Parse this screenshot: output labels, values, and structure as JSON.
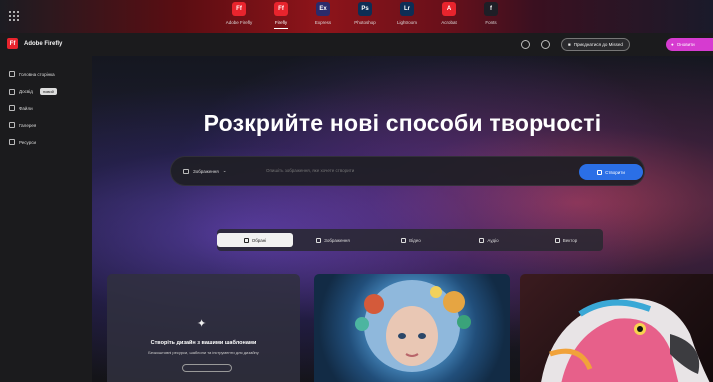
{
  "appbar": {
    "apps": [
      {
        "label": "Adobe Firefly",
        "short": "Ff",
        "color": "#e8242d",
        "active": false
      },
      {
        "label": "Firefly",
        "short": "Ff",
        "color": "#e8242d",
        "active": true
      },
      {
        "label": "Express",
        "short": "Ex",
        "color": "#2b2b6b",
        "active": false
      },
      {
        "label": "Photoshop",
        "short": "Ps",
        "color": "#0d2e55",
        "active": false
      },
      {
        "label": "Lightroom",
        "short": "Lr",
        "color": "#0d2e55",
        "active": false
      },
      {
        "label": "Acrobat",
        "short": "A",
        "color": "#e8242d",
        "active": false
      },
      {
        "label": "Fonts",
        "short": "f",
        "color": "#1e1e26",
        "active": false
      }
    ]
  },
  "header": {
    "brand": "Adobe Firefly",
    "brand_logo": "Ff",
    "try_label": "Приєднатися до Missed",
    "upgrade_label": "Оновити"
  },
  "sidebar": {
    "items": [
      {
        "label": "Головна сторінка",
        "icon": "home-icon",
        "badge": ""
      },
      {
        "label": "Досвід",
        "icon": "image-icon",
        "badge": "новий"
      },
      {
        "label": "Файли",
        "icon": "folder-icon",
        "badge": ""
      },
      {
        "label": "Галерея",
        "icon": "gallery-icon",
        "badge": ""
      },
      {
        "label": "Ресурси",
        "icon": "book-icon",
        "badge": ""
      }
    ]
  },
  "hero": {
    "title": "Розкрийте нові способи творчості"
  },
  "prompt": {
    "model_label": "Зображення",
    "placeholder": "Опишіть зображення, яке хочете створити",
    "generate_label": "Створити"
  },
  "filters": {
    "tabs": [
      {
        "label": "Обрані",
        "icon": "star-icon",
        "active": true
      },
      {
        "label": "Зображення",
        "icon": "image-icon",
        "active": false
      },
      {
        "label": "Відео",
        "icon": "video-icon",
        "active": false
      },
      {
        "label": "Аудіо",
        "icon": "audio-icon",
        "active": false
      },
      {
        "label": "Вектор",
        "icon": "vector-icon",
        "active": false
      }
    ]
  },
  "promo": {
    "title": "Створіть дизайн з вашими шаблонами",
    "subtitle": "Безкоштовні ресурси, шаблони та інструменти для дизайну"
  },
  "colors": {
    "accent": "#2b6fe6",
    "brand": "#e8242d",
    "upgrade": "#d63bd0"
  }
}
